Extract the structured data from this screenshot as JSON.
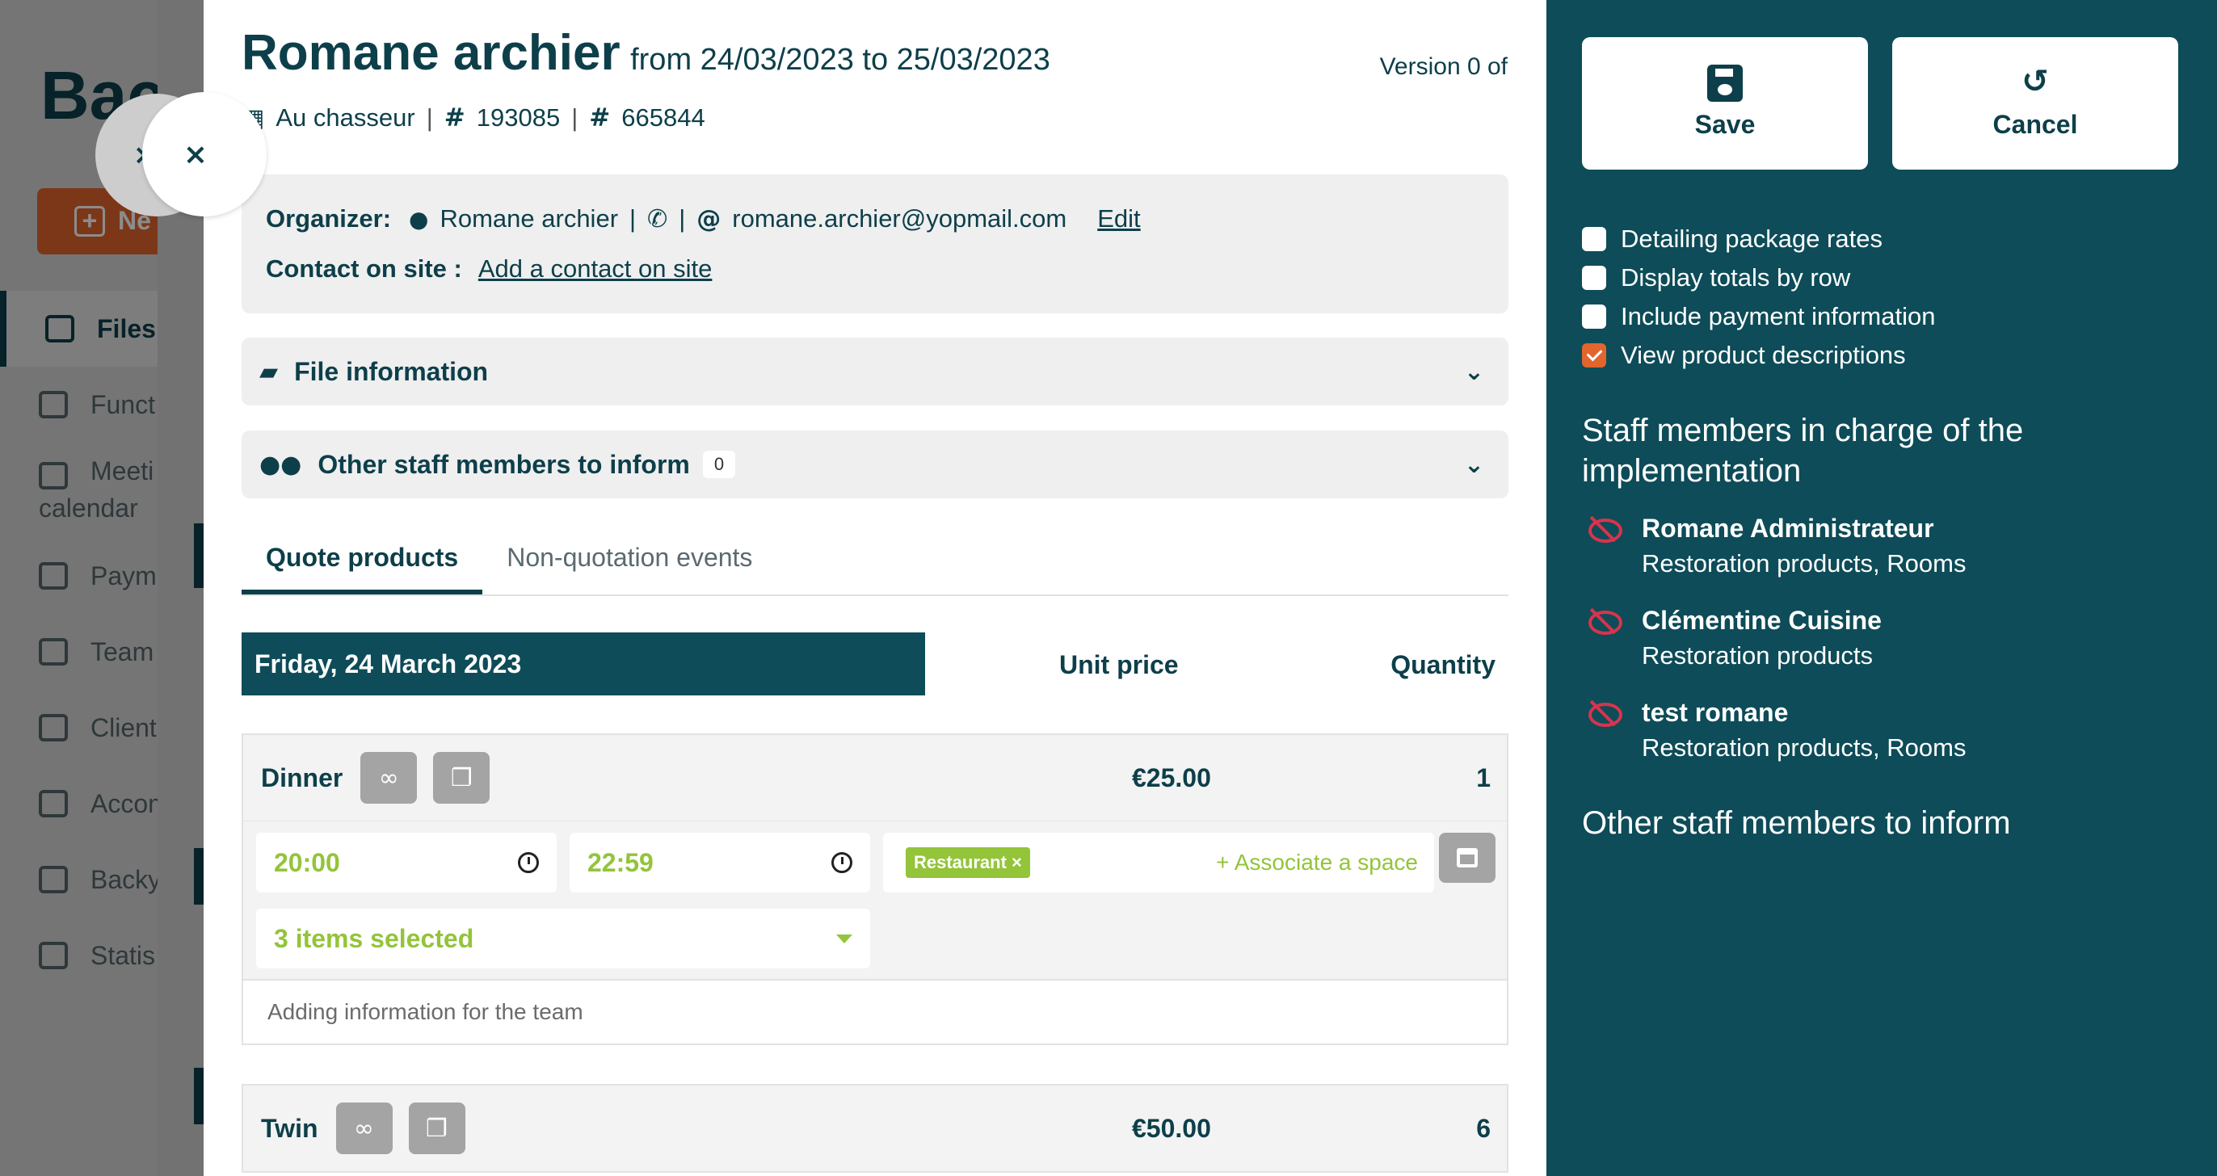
{
  "background": {
    "title_partial": "Bac",
    "new_button_partial": "Ne",
    "menu": [
      {
        "label": "Files",
        "active": true
      },
      {
        "label": "Funct",
        "active": false
      },
      {
        "label": "Meeti",
        "label2": "calendar",
        "active": false
      },
      {
        "label": "Paym",
        "active": false
      },
      {
        "label": "Team",
        "active": false
      },
      {
        "label": "Client",
        "active": false
      },
      {
        "label": "Accom",
        "active": false
      },
      {
        "label": "Backy",
        "active": false
      },
      {
        "label": "Statis",
        "active": false
      }
    ]
  },
  "close_label": "×",
  "header": {
    "name": "Romane archier",
    "dates": "from 24/03/2023 to 25/03/2023",
    "version": "Version 0 of",
    "venue": "Au chasseur",
    "file_number": "193085",
    "secondary_number": "665844"
  },
  "organizer": {
    "label": "Organizer:",
    "name": "Romane archier",
    "email": "romane.archier@yopmail.com",
    "edit_label": "Edit",
    "contact_label": "Contact on site :",
    "add_contact_label": "Add a contact on site"
  },
  "accordions": {
    "file_info": "File information",
    "other_staff": "Other staff members to inform",
    "other_staff_count": "0"
  },
  "tabs": [
    {
      "label": "Quote products",
      "active": true
    },
    {
      "label": "Non-quotation events",
      "active": false
    }
  ],
  "table": {
    "day": "Friday, 24 March 2023",
    "col_unit_price": "Unit price",
    "col_quantity": "Quantity"
  },
  "products": [
    {
      "name": "Dinner",
      "price": "€25.00",
      "quantity": "1",
      "start_time": "20:00",
      "end_time": "22:59",
      "space_tag": "Restaurant",
      "associate_label": "Associate a space",
      "selection": "3 items selected",
      "note_placeholder": "Adding information for the team"
    },
    {
      "name": "Twin",
      "price": "€50.00",
      "quantity": "6"
    }
  ],
  "panel": {
    "save_label": "Save",
    "cancel_label": "Cancel",
    "options": [
      {
        "label": "Detailing package rates",
        "checked": false
      },
      {
        "label": "Display totals by row",
        "checked": false
      },
      {
        "label": "Include payment information",
        "checked": false
      },
      {
        "label": "View product descriptions",
        "checked": true
      }
    ],
    "staff_title": "Staff members in charge of the implementation",
    "staff": [
      {
        "name": "Romane Administrateur",
        "roles": "Restoration products, Rooms"
      },
      {
        "name": "Clémentine Cuisine",
        "roles": "Restoration products"
      },
      {
        "name": "test romane",
        "roles": "Restoration products, Rooms"
      }
    ],
    "inform_title": "Other staff members to inform"
  },
  "colors": {
    "primary": "#0d4c58",
    "accent_green": "#93c43a",
    "accent_orange": "#e2652e",
    "hidden_red": "#d9334d"
  }
}
